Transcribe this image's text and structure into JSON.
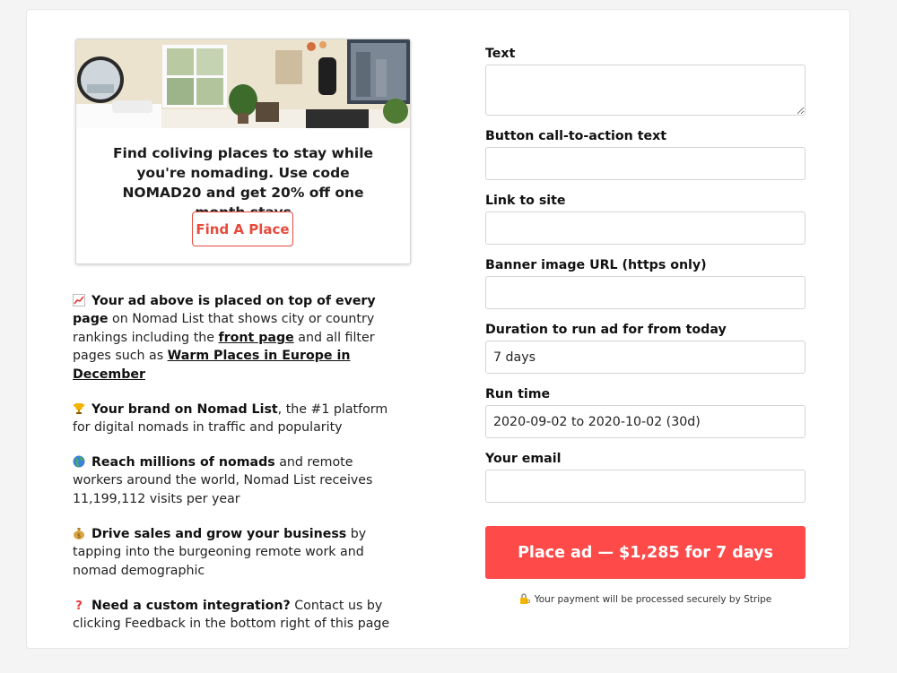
{
  "ad_preview": {
    "banner_image": "coliving-room-photo",
    "text": "Find coliving places to stay while you're nomading. Use code NOMAD20 and get 20% off one month stays",
    "button_label": "Find A Place"
  },
  "features": [
    {
      "icon": "chart-increasing-icon",
      "bold": "Your ad above is placed on top of every page",
      "text1": " on Nomad List that shows city or country rankings including the ",
      "link1": "front page",
      "text2": " and all filter pages such as ",
      "link2": "Warm Places in Europe in December"
    },
    {
      "icon": "trophy-icon",
      "bold": "Your brand on Nomad List",
      "text": ", the #1 platform for digital nomads in traffic and popularity"
    },
    {
      "icon": "globe-icon",
      "bold": "Reach millions of nomads",
      "text": " and remote workers around the world, Nomad List receives 11,199,112 visits per year"
    },
    {
      "icon": "money-bag-icon",
      "bold": "Drive sales and grow your business",
      "text": " by tapping into the burgeoning remote work and nomad demographic"
    },
    {
      "icon": "question-mark-icon",
      "bold": "Need a custom integration?",
      "text": " Contact us by clicking Feedback in the bottom right of this page"
    }
  ],
  "form": {
    "text_label": "Text",
    "text_value": "",
    "cta_label": "Button call-to-action text",
    "cta_value": "",
    "link_label": "Link to site",
    "link_value": "",
    "banner_label": "Banner image URL (https only)",
    "banner_value": "",
    "duration_label": "Duration to run ad for from today",
    "duration_value": "7 days",
    "runtime_label": "Run time",
    "runtime_value": "2020-09-02 to 2020-10-02 (30d)",
    "email_label": "Your email",
    "email_value": "",
    "submit_label": "Place ad — $1,285 for 7 days",
    "secure_note": "Your payment will be processed securely by Stripe",
    "secure_icon": "lock-with-key-icon"
  },
  "colors": {
    "accent_red": "#fe4a49",
    "ad_button_red": "#e64b3c"
  }
}
